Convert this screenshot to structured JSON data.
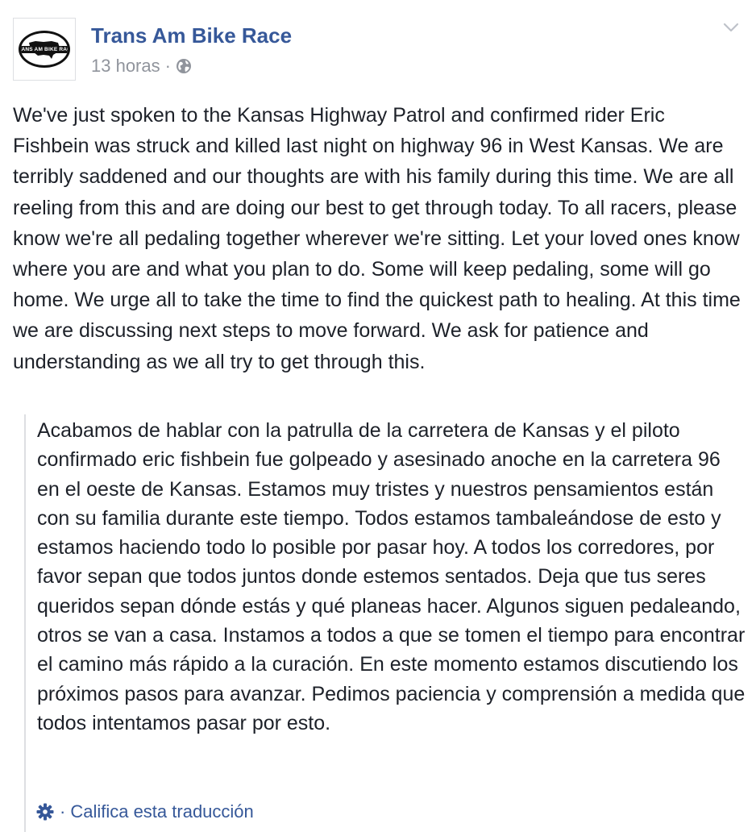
{
  "post": {
    "page_name": "Trans Am Bike Race",
    "timestamp": "13 horas",
    "separator": "·",
    "avatar_logo_text": "TRANS AM BIKE RACE",
    "privacy_icon": "globe-icon",
    "options_icon": "chevron-down-icon",
    "body": "We've just spoken to the Kansas Highway Patrol and confirmed rider Eric Fishbein was struck and killed last night on highway 96 in West Kansas. We are terribly saddened and our thoughts are with his family during this time. We are all reeling from this and are doing our best to get through today. To all racers, please know we're all pedaling together wherever we're sitting. Let your loved ones know where you are and what you plan to do. Some will keep pedaling, some will go home. We urge all to take the time to find the quickest path to healing. At this time we are discussing next steps to move forward. We ask for patience and understanding as we all try to get through this."
  },
  "translation": {
    "text": "Acabamos de hablar con la patrulla de la carretera de Kansas y el piloto confirmado eric fishbein fue golpeado y asesinado anoche en la carretera 96 en el oeste de Kansas. Estamos muy tristes y nuestros pensamientos están con su familia durante este tiempo. Todos estamos tambaleándose de esto y estamos haciendo todo lo posible por pasar hoy. A todos los corredores, por favor sepan que todos juntos donde estemos sentados. Deja que tus seres queridos sepan dónde estás y qué planeas hacer. Algunos siguen pedaleando, otros se van a casa. Instamos a todos a que se tomen el tiempo para encontrar el camino más rápido a la curación. En este momento estamos discutiendo los próximos pasos para avanzar. Pedimos paciencia y comprensión a medida que todos intentamos pasar por esto.",
    "rate_separator": "·",
    "rate_label": "Califica esta traducción",
    "rate_icon": "gear-icon"
  },
  "colors": {
    "link_blue": "#365899",
    "text": "#1d2129",
    "meta_gray": "#90949c",
    "divider": "#dddfe2"
  }
}
